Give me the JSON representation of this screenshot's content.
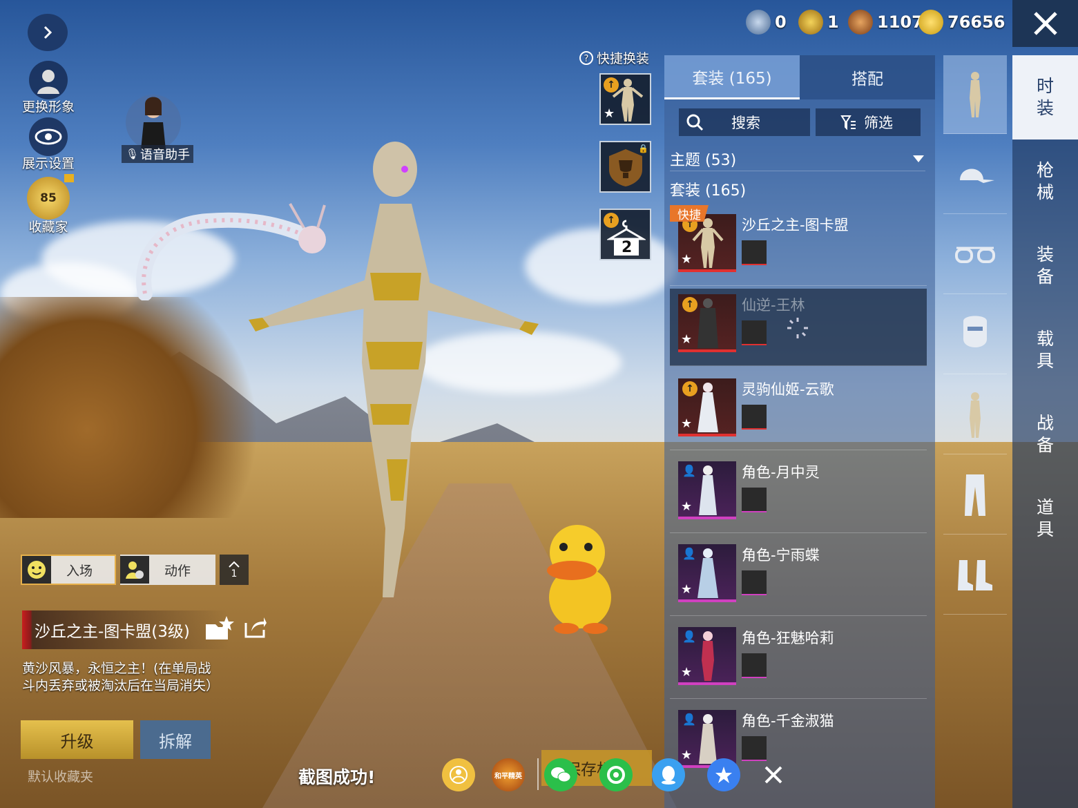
{
  "hud": {
    "change_avatar": "更换形象",
    "display_settings": "展示设置",
    "collector": "收藏家",
    "collector_level": "85",
    "voice_assistant": "语音助手"
  },
  "motion": {
    "entrance": "入场",
    "action": "动作",
    "extra": "1"
  },
  "outfit": {
    "title": "沙丘之主-图卡盟(3级)",
    "description": "黄沙风暴，永恒之主！(在单局战斗内丢弃或被淘汰后在当局消失）",
    "upgrade": "升级",
    "dismantle": "拆解",
    "default_folder": "默认收藏夹"
  },
  "quick_change": {
    "label": "快捷换装",
    "slot3_number": "2"
  },
  "currency": [
    {
      "icon": "blue-coin-icon",
      "value": "0"
    },
    {
      "icon": "gold-badge-icon",
      "value": "1"
    },
    {
      "icon": "bronze-coin-icon",
      "value": "1107"
    },
    {
      "icon": "lightning-coin-icon",
      "value": "76656"
    }
  ],
  "panel": {
    "tab_sets": "套装 (165)",
    "tab_match": "搭配",
    "search": "搜索",
    "filter": "筛选",
    "theme": "主题 (53)",
    "sets": "套装 (165)",
    "quick_badge": "快捷"
  },
  "items": [
    {
      "name": "沙丘之主-图卡盟",
      "rarity": "red",
      "badge": "up"
    },
    {
      "name": "仙逆-王林",
      "rarity": "red",
      "badge": "up"
    },
    {
      "name": "灵驹仙姬-云歌",
      "rarity": "red",
      "badge": "up"
    },
    {
      "name": "角色-月中灵",
      "rarity": "purple",
      "badge": "char"
    },
    {
      "name": "角色-宁雨蝶",
      "rarity": "purple",
      "badge": "char"
    },
    {
      "name": "角色-狂魅哈莉",
      "rarity": "purple",
      "badge": "char"
    },
    {
      "name": "角色-千金淑猫",
      "rarity": "purple",
      "badge": "char"
    }
  ],
  "categories": [
    "时\n装",
    "枪\n械",
    "装\n备",
    "载\n具",
    "战\n备",
    "道\n具"
  ],
  "bottom": {
    "screenshot_ok": "截图成功!",
    "save_label": "保存相册",
    "game_logo_text": "和平精英"
  },
  "colors": {
    "accent_gold": "#e5c04d",
    "rarity_red": "#e03030",
    "rarity_purple": "#d040c0",
    "panel_blue": "#3c5f96"
  }
}
